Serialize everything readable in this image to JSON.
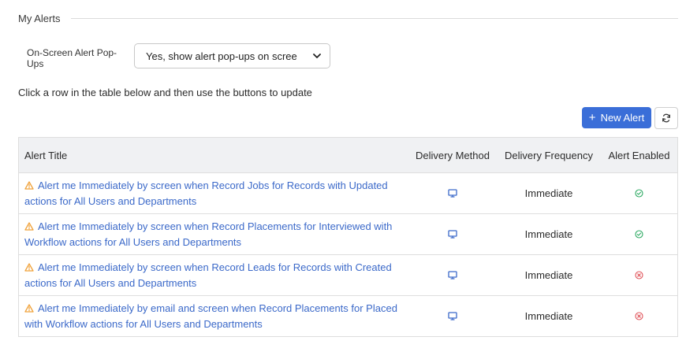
{
  "section": {
    "title": "My Alerts"
  },
  "popup_setting": {
    "label": "On-Screen Alert Pop-Ups",
    "selected": "Yes, show alert pop-ups on scree"
  },
  "instructions": "Click a row in the table below and then use the buttons to update",
  "toolbar": {
    "new_alert_label": "New Alert"
  },
  "table": {
    "headers": {
      "title": "Alert Title",
      "method": "Delivery Method",
      "frequency": "Delivery Frequency",
      "enabled": "Alert Enabled"
    },
    "rows": [
      {
        "title": "Alert me Immediately by screen when Record Jobs for Records with Updated actions for All Users and Departments",
        "method_icon": "monitor-icon",
        "frequency": "Immediate",
        "enabled": true
      },
      {
        "title": "Alert me Immediately by screen when Record Placements for Interviewed with Workflow actions for All Users and Departments",
        "method_icon": "monitor-icon",
        "frequency": "Immediate",
        "enabled": true
      },
      {
        "title": "Alert me Immediately by screen when Record Leads for Records with Created actions for All Users and Departments",
        "method_icon": "monitor-icon",
        "frequency": "Immediate",
        "enabled": false
      },
      {
        "title": "Alert me Immediately by email and screen when Record Placements for Placed with Workflow actions for All Users and Departments",
        "method_icon": "monitor-icon",
        "frequency": "Immediate",
        "enabled": false
      }
    ]
  },
  "colors": {
    "accent": "#3a6ed8",
    "link": "#3b69c9",
    "warning": "#f0a23b",
    "enabled": "#2eaa63",
    "disabled": "#e0555b",
    "header_bg": "#f0f1f3"
  }
}
